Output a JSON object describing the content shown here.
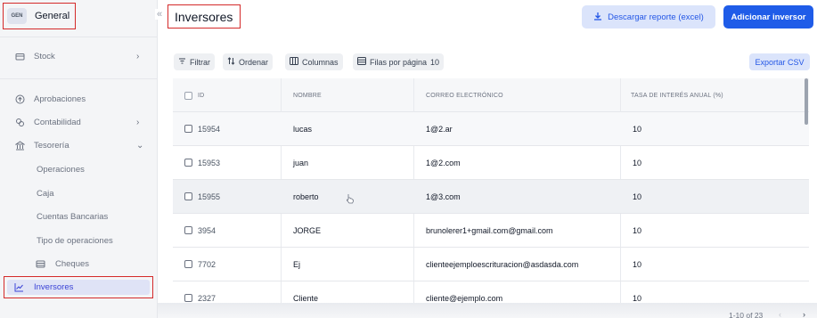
{
  "org": {
    "badge": "GEN",
    "name": "General"
  },
  "collapse_glyph": "«",
  "sidebar": {
    "items": [
      {
        "label": "Stock",
        "icon": "box-icon",
        "chevron": "›"
      },
      {
        "label": "Aprobaciones",
        "icon": "circle-up-icon"
      },
      {
        "label": "Contabilidad",
        "icon": "accounting-icon",
        "chevron": "›"
      },
      {
        "label": "Tesorería",
        "icon": "bank-icon",
        "chevron": "⌄"
      },
      {
        "label": "Operaciones"
      },
      {
        "label": "Caja"
      },
      {
        "label": "Cuentas Bancarias"
      },
      {
        "label": "Tipo de operaciones"
      },
      {
        "label": "Cheques",
        "icon": "cheque-icon"
      },
      {
        "label": "Inversores",
        "icon": "chart-line-icon",
        "active": true
      }
    ]
  },
  "header": {
    "title": "Inversores",
    "download_label": "Descargar reporte (excel)",
    "add_label": "Adicionar inversor"
  },
  "toolbar": {
    "filter_label": "Filtrar",
    "sort_label": "Ordenar",
    "columns_label": "Columnas",
    "rows_per_page_label": "Filas por página",
    "rows_per_page_value": "10",
    "export_label": "Exportar CSV"
  },
  "table": {
    "columns": [
      "ID",
      "NOMBRE",
      "CORREO ELECTRÓNICO",
      "TASA DE INTERÉS ANUAL (%)"
    ],
    "rows": [
      {
        "id": "15954",
        "nombre": "lucas",
        "correo": "1@2.ar",
        "tasa": "10"
      },
      {
        "id": "15953",
        "nombre": "juan",
        "correo": "1@2.com",
        "tasa": "10"
      },
      {
        "id": "15955",
        "nombre": "roberto",
        "correo": "1@3.com",
        "tasa": "10"
      },
      {
        "id": "3954",
        "nombre": "JORGE",
        "correo": "brunolerer1+gmail.com@gmail.com",
        "tasa": "10"
      },
      {
        "id": "7702",
        "nombre": "Ej",
        "correo": "clienteejemploescrituracion@asdasda.com",
        "tasa": "10"
      },
      {
        "id": "2327",
        "nombre": "Cliente",
        "correo": "cliente@ejemplo.com",
        "tasa": "10"
      }
    ]
  },
  "pagination": {
    "text": "1-10 of 23",
    "prev": "‹",
    "next": "›"
  },
  "colors": {
    "accent": "#1f5ce8",
    "active_bg": "#dfe3f6",
    "highlight_border": "#d42a2a"
  }
}
